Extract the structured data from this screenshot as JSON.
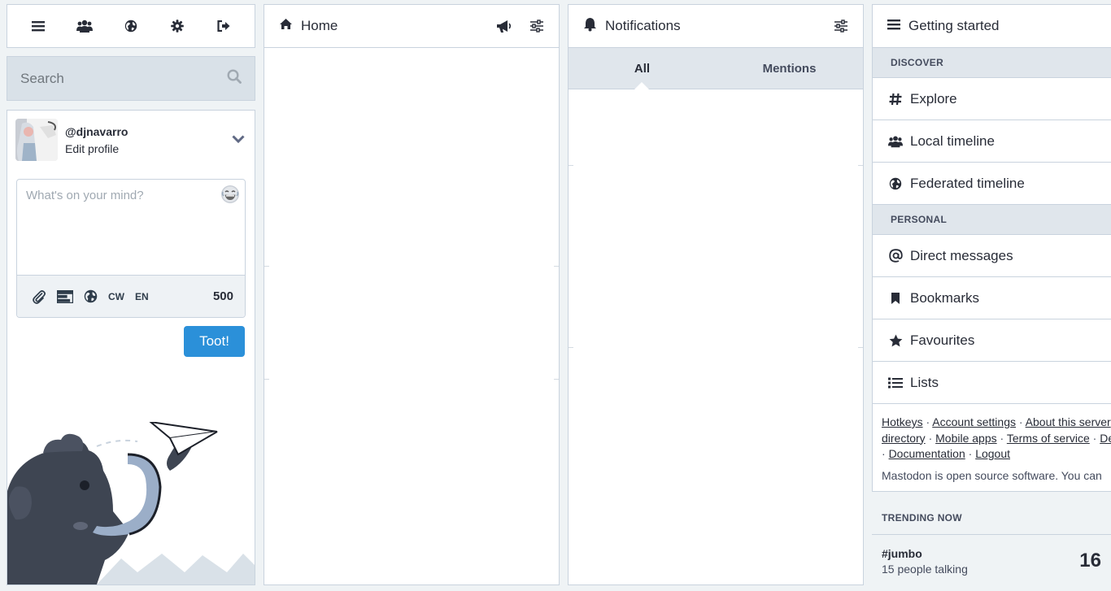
{
  "navbar": {
    "icons": [
      "menu-icon",
      "local-timeline-icon",
      "federated-timeline-icon",
      "preferences-icon",
      "logout-icon"
    ]
  },
  "search": {
    "placeholder": "Search"
  },
  "profile": {
    "acct": "@djnavarro",
    "edit_label": "Edit profile"
  },
  "compose": {
    "placeholder": "What's on your mind?",
    "cw_label": "CW",
    "language_label": "EN",
    "char_count": "500",
    "submit_label": "Toot!"
  },
  "home": {
    "title": "Home"
  },
  "notifications": {
    "title": "Notifications",
    "tabs": [
      {
        "label": "All"
      },
      {
        "label": "Mentions"
      }
    ]
  },
  "getting_started": {
    "title": "Getting started",
    "discover_heading": "DISCOVER",
    "discover_items": [
      {
        "label": "Explore"
      },
      {
        "label": "Local timeline"
      },
      {
        "label": "Federated timeline"
      }
    ],
    "personal_heading": "PERSONAL",
    "personal_items": [
      {
        "label": "Direct messages"
      },
      {
        "label": "Bookmarks"
      },
      {
        "label": "Favourites"
      },
      {
        "label": "Lists"
      }
    ],
    "footer_links": [
      "Hotkeys",
      "Account settings",
      "About this server",
      "directory",
      "Mobile apps",
      "Terms of service",
      "De",
      "Documentation",
      "Logout"
    ],
    "about_text": "Mastodon is open source software. You can"
  },
  "trending": {
    "title": "TRENDING NOW",
    "items": [
      {
        "tag": "#jumbo",
        "people": "15 people talking",
        "count": "16"
      }
    ]
  },
  "colors": {
    "accent": "#2b90d9",
    "panel_bg": "#d9e1e8",
    "text": "#282c37"
  }
}
